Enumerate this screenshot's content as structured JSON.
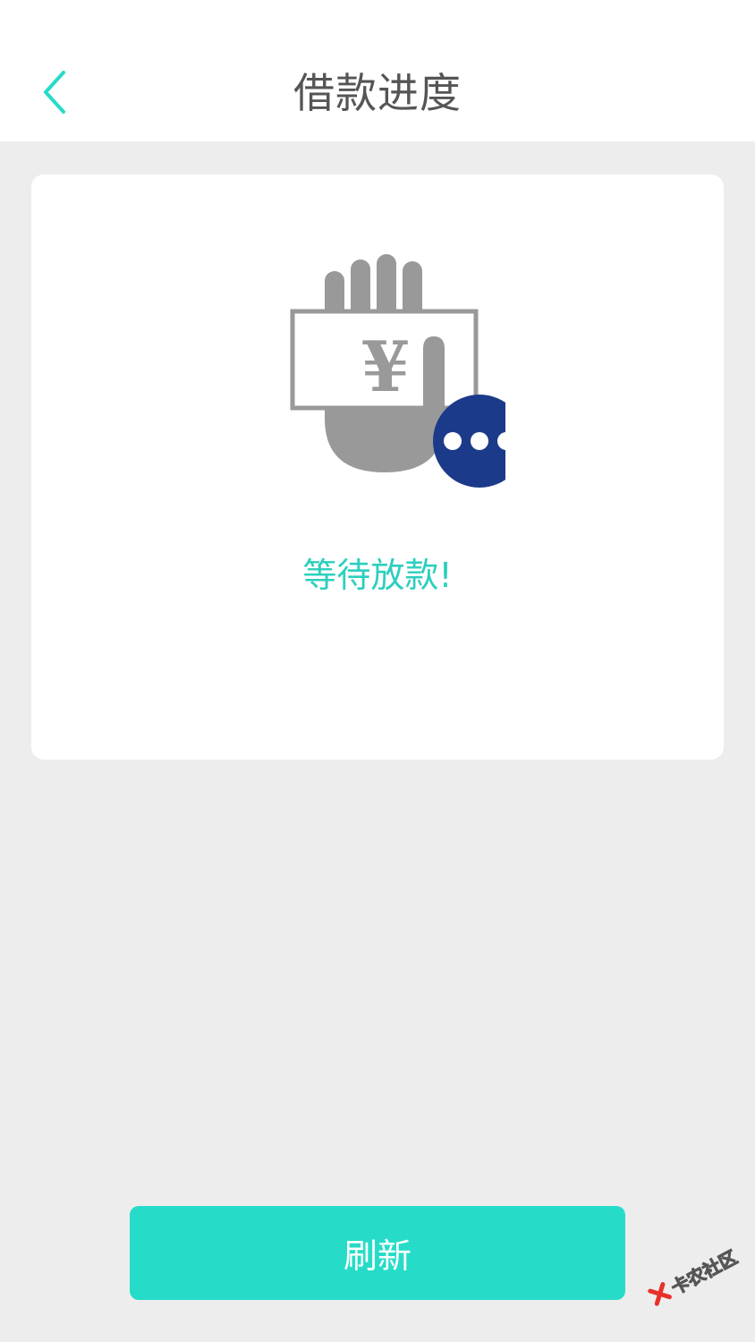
{
  "header": {
    "title": "借款进度",
    "back_icon": "chevron-left-icon"
  },
  "card": {
    "illustration_icon": "hand-money-pending-icon",
    "currency_symbol": "¥",
    "status_text": "等待放款!"
  },
  "actions": {
    "refresh_label": "刷新"
  },
  "watermark": {
    "text": "卡农社区"
  },
  "colors": {
    "accent": "#26dcc8",
    "status_text": "#2ccfbe",
    "title": "#555555",
    "icon_gray": "#999999",
    "badge_navy": "#1b3a8a",
    "background": "#ededed"
  }
}
